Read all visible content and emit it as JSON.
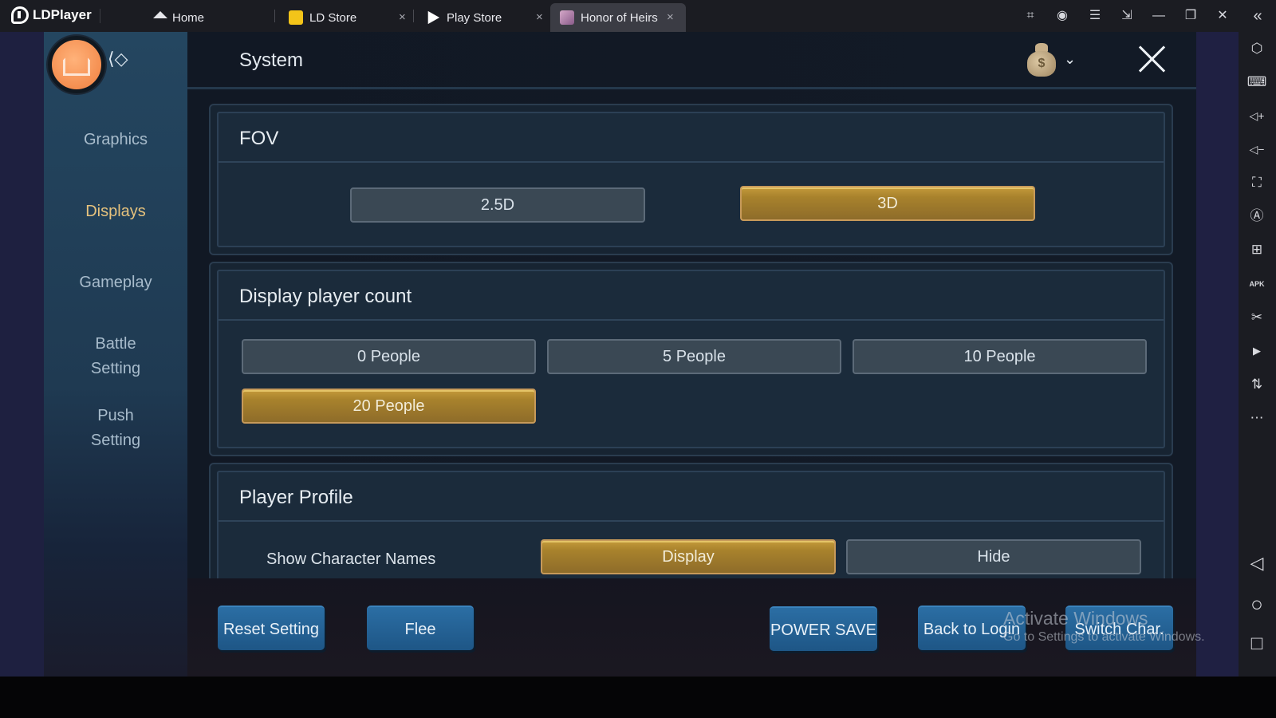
{
  "app": {
    "name": "LDPlayer",
    "tabs": [
      {
        "label": "Home",
        "icon": "home-icon",
        "closable": false,
        "active": false
      },
      {
        "label": "LD Store",
        "icon": "gamepad-store-icon",
        "closable": true,
        "active": false
      },
      {
        "label": "Play Store",
        "icon": "play-store-icon",
        "closable": true,
        "active": false
      },
      {
        "label": "Honor of Heirs",
        "icon": "game-thumbnail-icon",
        "closable": true,
        "active": true
      }
    ],
    "close_glyph": "×",
    "window_controls": [
      {
        "name": "gamepad-icon",
        "glyph": "🎮"
      },
      {
        "name": "account-icon",
        "glyph": "◉"
      },
      {
        "name": "menu-icon",
        "glyph": "☰"
      },
      {
        "name": "popout-icon",
        "glyph": "⇲"
      },
      {
        "name": "minimize-icon",
        "glyph": "—"
      },
      {
        "name": "restore-icon",
        "glyph": "❐"
      },
      {
        "name": "close-window-icon",
        "glyph": "✕"
      },
      {
        "name": "collapse-sidebar-icon",
        "glyph": "«"
      }
    ],
    "right_toolbar": [
      {
        "name": "settings-hex-icon",
        "glyph": "⬡"
      },
      {
        "name": "keyboard-icon",
        "glyph": "⌨"
      },
      {
        "name": "volume-up-icon",
        "glyph": "◁+"
      },
      {
        "name": "volume-down-icon",
        "glyph": "◁−"
      },
      {
        "name": "fullscreen-icon",
        "glyph": "⛶"
      },
      {
        "name": "auto-rotate-icon",
        "glyph": "Ⓐ"
      },
      {
        "name": "multi-instance-icon",
        "glyph": "⊞"
      },
      {
        "name": "apk-install-icon",
        "glyph": "APK"
      },
      {
        "name": "scissors-icon",
        "glyph": "✂"
      },
      {
        "name": "video-record-icon",
        "glyph": "▶"
      },
      {
        "name": "sync-icon",
        "glyph": "⇅"
      },
      {
        "name": "more-icon",
        "glyph": "⋯"
      }
    ],
    "android_nav": [
      {
        "name": "back-icon",
        "glyph": "◁"
      },
      {
        "name": "home-circle-icon",
        "glyph": "○"
      },
      {
        "name": "recents-icon",
        "glyph": "□"
      }
    ]
  },
  "game": {
    "title": "System",
    "sidebar": [
      {
        "label": "Graphics",
        "active": false
      },
      {
        "label": "Displays",
        "active": true
      },
      {
        "label": "Gameplay",
        "active": false
      },
      {
        "label": "Battle\nSetting",
        "active": false
      },
      {
        "label": "Push\nSetting",
        "active": false
      }
    ],
    "sections": {
      "fov": {
        "title": "FOV",
        "options": [
          {
            "label": "2.5D",
            "selected": false
          },
          {
            "label": "3D",
            "selected": true
          }
        ]
      },
      "player_count": {
        "title": "Display player count",
        "options": [
          {
            "label": "0 People",
            "selected": false
          },
          {
            "label": "5 People",
            "selected": false
          },
          {
            "label": "10 People",
            "selected": false
          },
          {
            "label": "20 People",
            "selected": true
          }
        ]
      },
      "profile": {
        "title": "Player Profile",
        "row_label": "Show Character Names",
        "options": [
          {
            "label": "Display",
            "selected": true
          },
          {
            "label": "Hide",
            "selected": false
          }
        ]
      }
    },
    "bottom_buttons": [
      "Reset Setting",
      "Flee",
      "POWER SAVE",
      "Back to Login",
      "Switch Char."
    ],
    "currency_glyph": "$",
    "chevron_glyph": "⌄"
  },
  "watermark": {
    "line1": "Activate Windows",
    "line2": "Go to Settings to activate Windows."
  },
  "colors": {
    "selected_gold": "#a8822c",
    "button_blue": "#2b6ea4",
    "active_nav": "#e6c27d"
  }
}
